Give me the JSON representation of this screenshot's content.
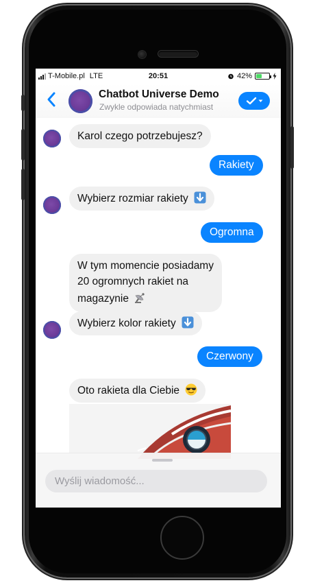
{
  "status_bar": {
    "carrier": "T-Mobile.pl",
    "network": "LTE",
    "time": "20:51",
    "battery": "42%",
    "battery_level": 0.42
  },
  "header": {
    "title": "Chatbot Universe Demo",
    "subtitle": "Zwykle odpowiada natychmiast",
    "back_icon": "chevron-left-icon",
    "manage_icon": "checkmark-dropdown-icon",
    "accent_color": "#0a84ff"
  },
  "messages": [
    {
      "from": "bot",
      "text": "Karol czego potrzebujesz?"
    },
    {
      "from": "user",
      "text": "Rakiety"
    },
    {
      "from": "bot",
      "text": "Wybierz rozmiar rakiety",
      "emoji": "down-arrow-icon"
    },
    {
      "from": "user",
      "text": "Ogromna"
    },
    {
      "from": "bot",
      "lines": [
        "W tym momencie posiadamy",
        "20 ogromnych rakiet na",
        "magazynie"
      ],
      "emoji": "satellite-antenna-icon"
    },
    {
      "from": "bot",
      "text": "Wybierz kolor rakiety",
      "emoji": "down-arrow-icon"
    },
    {
      "from": "user",
      "text": "Czerwony"
    },
    {
      "from": "bot",
      "text": "Oto rakieta dla Ciebie",
      "emoji": "sunglasses-face-icon"
    },
    {
      "from": "bot",
      "image": "red-rocket-image"
    }
  ],
  "composer": {
    "placeholder": "Wyślij wiadomość..."
  }
}
